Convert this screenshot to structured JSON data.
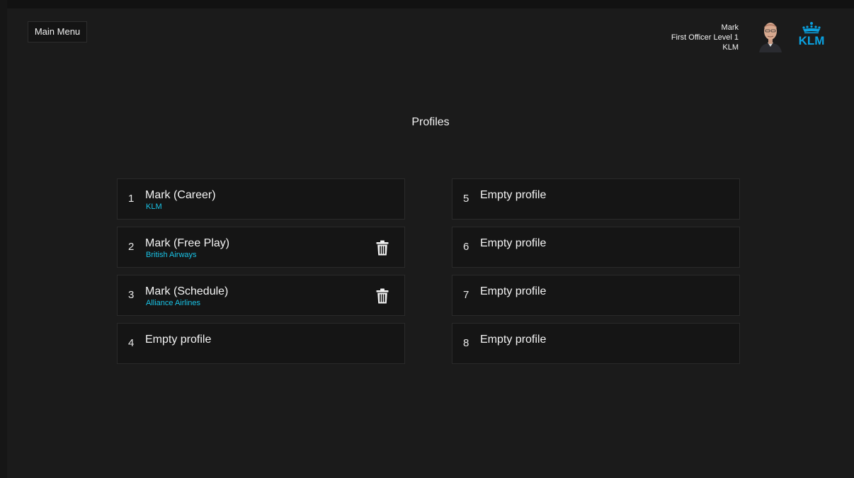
{
  "header": {
    "main_menu_label": "Main Menu",
    "user": {
      "name": "Mark",
      "rank": "First Officer Level 1",
      "airline": "KLM"
    },
    "logo_text": "KLM",
    "logo_color": "#0aa1e0"
  },
  "page": {
    "title": "Profiles"
  },
  "profiles": [
    {
      "number": "1",
      "name": "Mark (Career)",
      "airline": "KLM",
      "deletable": false
    },
    {
      "number": "2",
      "name": "Mark (Free Play)",
      "airline": "British Airways",
      "deletable": true
    },
    {
      "number": "3",
      "name": "Mark (Schedule)",
      "airline": "Alliance Airlines",
      "deletable": true
    },
    {
      "number": "4",
      "name": "Empty profile",
      "airline": "",
      "deletable": false
    },
    {
      "number": "5",
      "name": "Empty profile",
      "airline": "",
      "deletable": false
    },
    {
      "number": "6",
      "name": "Empty profile",
      "airline": "",
      "deletable": false
    },
    {
      "number": "7",
      "name": "Empty profile",
      "airline": "",
      "deletable": false
    },
    {
      "number": "8",
      "name": "Empty profile",
      "airline": "",
      "deletable": false
    }
  ],
  "colors": {
    "background": "#1b1b1b",
    "card": "#151515",
    "accent": "#19c3e6"
  },
  "icons": {
    "delete": "trash-icon",
    "avatar": "pilot-avatar",
    "logo": "klm-crown-logo"
  }
}
